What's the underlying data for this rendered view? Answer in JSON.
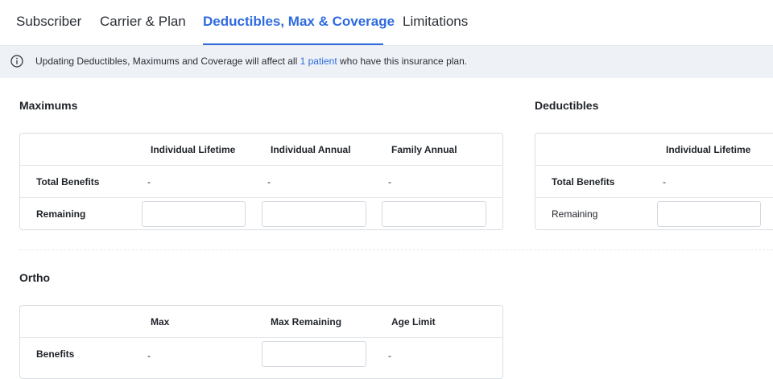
{
  "tabs": [
    {
      "label": "Subscriber",
      "active": false
    },
    {
      "label": "Carrier & Plan",
      "active": false
    },
    {
      "label": "Deductibles, Max & Coverage",
      "active": true
    },
    {
      "label": "Limitations",
      "active": false
    }
  ],
  "banner": {
    "icon": "info-icon",
    "text_before": "Updating Deductibles, Maximums and Coverage will affect all ",
    "link_text": "1 patient",
    "text_after": " who have this insurance plan."
  },
  "maximums": {
    "title": "Maximums",
    "columns": [
      "Individual Lifetime",
      "Individual Annual",
      "Family Annual"
    ],
    "rows": [
      {
        "label": "Total Benefits",
        "values": [
          "-",
          "-",
          "-"
        ]
      },
      {
        "label": "Remaining",
        "inputs": [
          "",
          "",
          ""
        ]
      }
    ]
  },
  "deductibles": {
    "title": "Deductibles",
    "columns": [
      "Individual Lifetime"
    ],
    "rows": [
      {
        "label": "Total Benefits",
        "values": [
          "-"
        ]
      },
      {
        "label": "Remaining",
        "inputs": [
          ""
        ]
      }
    ]
  },
  "ortho": {
    "title": "Ortho",
    "columns": [
      "Max",
      "Max Remaining",
      "Age Limit"
    ],
    "rows": [
      {
        "label": "Benefits",
        "values": [
          "-",
          "",
          "-"
        ]
      }
    ]
  },
  "colors": {
    "accent": "#2f6bde",
    "banner_bg": "#eef2f7",
    "border": "#d9dde3"
  }
}
